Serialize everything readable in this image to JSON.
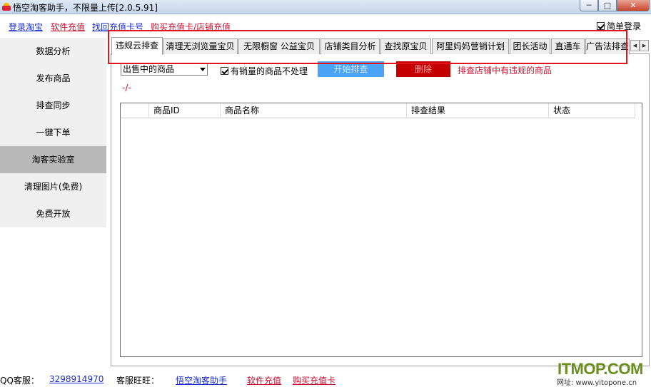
{
  "window": {
    "title": "悟空淘客助手，不限量上传[2.0.5.91]",
    "min_glyph": "─",
    "max_glyph": "□",
    "close_glyph": "✕"
  },
  "toplinks": [
    {
      "label": "登录淘宝",
      "color": "#1b2cc9"
    },
    {
      "label": "软件充值",
      "color": "#c8102e"
    },
    {
      "label": "找回充值卡号",
      "color": "#1b2cc9"
    },
    {
      "label": "购买充值卡/店铺充值",
      "color": "#c8102e"
    }
  ],
  "simple_login": {
    "label": "简单登录",
    "checked": true
  },
  "sidebar": {
    "items": [
      {
        "label": "数据分析"
      },
      {
        "label": "发布商品"
      },
      {
        "label": "排查同步"
      },
      {
        "label": "一键下单"
      },
      {
        "label": "淘客实验室",
        "active": true
      },
      {
        "label": "清理图片(免费)"
      },
      {
        "label": "免费开放"
      }
    ]
  },
  "tabs": [
    {
      "label": "违规云排查",
      "active": true
    },
    {
      "label": "清理无浏览量宝贝"
    },
    {
      "label": "无限橱窗 公益宝贝"
    },
    {
      "label": "店铺类目分析"
    },
    {
      "label": "查找原宝贝"
    },
    {
      "label": "阿里妈妈营销计划"
    },
    {
      "label": "团长活动"
    },
    {
      "label": "直通车"
    },
    {
      "label": "广告法排查"
    }
  ],
  "tab_scroll": {
    "left_glyph": "◀",
    "right_glyph": "▶"
  },
  "controls": {
    "select_value": "出售中的商品",
    "sold_checkbox_label": "有销量的商品不处理",
    "sold_checked": true,
    "start_button": "开始排查",
    "delete_button": "删除",
    "hint": "排查店铺中有违规的商品",
    "progress": "-/-"
  },
  "table": {
    "columns": [
      "商品ID",
      "商品名称",
      "排查结果",
      "状态"
    ],
    "rows": []
  },
  "bottom": {
    "qq_label": "QQ客服：",
    "qq_number": "3298914970",
    "wangwang_label": "客服旺旺：",
    "wangwang_name": "悟空淘客助手",
    "recharge": "软件充值",
    "buy_card": "购买充值卡"
  },
  "watermark": {
    "logo": "ITMOP.COM",
    "site": "网址: www.yitopone.cn"
  },
  "colors": {
    "highlight_box": "#e3121b",
    "start_button": "#4aa3f5",
    "delete_button": "#c40000",
    "sidebar_active": "#b9b9b9"
  }
}
